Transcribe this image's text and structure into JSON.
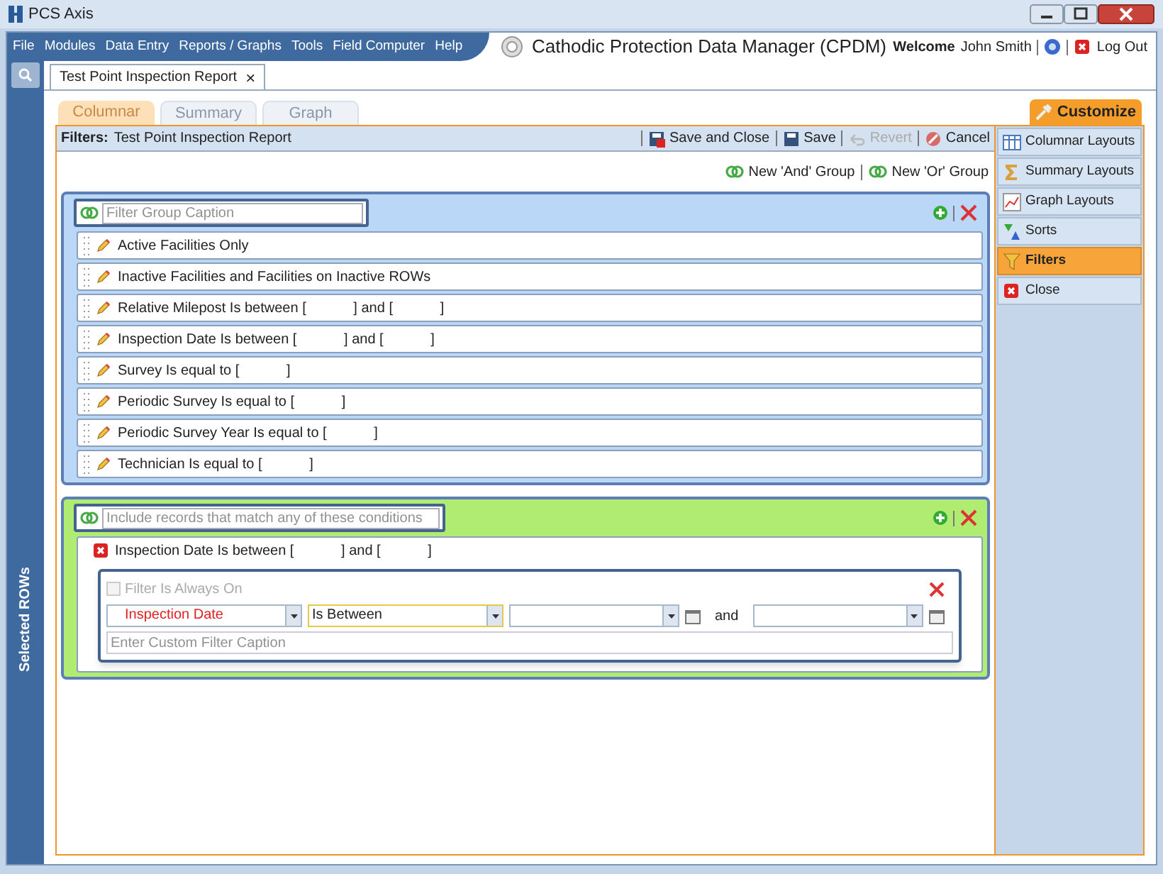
{
  "app": {
    "title": "PCS Axis"
  },
  "menu": [
    "File",
    "Modules",
    "Data Entry",
    "Reports / Graphs",
    "Tools",
    "Field Computer",
    "Help"
  ],
  "header": {
    "title": "Cathodic Protection Data Manager (CPDM)",
    "welcome": "Welcome",
    "user": "John Smith",
    "logout": "Log Out"
  },
  "document_tab": {
    "label": "Test Point Inspection Report",
    "close": "×"
  },
  "sidebar": {
    "label": "Selected ROWs"
  },
  "view_tabs": [
    {
      "label": "Columnar",
      "selected": true
    },
    {
      "label": "Summary",
      "selected": false
    },
    {
      "label": "Graph",
      "selected": false
    }
  ],
  "customize": {
    "label": "Customize"
  },
  "filters_bar": {
    "label": "Filters:",
    "value": "Test Point Inspection Report",
    "actions": [
      {
        "kind": "save_close",
        "label": "Save and Close",
        "disabled": false
      },
      {
        "kind": "save",
        "label": "Save",
        "disabled": false
      },
      {
        "kind": "revert",
        "label": "Revert",
        "disabled": true
      },
      {
        "kind": "cancel",
        "label": "Cancel",
        "disabled": false
      }
    ]
  },
  "group_actions": [
    "New 'And' Group",
    "New 'Or' Group"
  ],
  "groups": [
    {
      "kind": "and",
      "placeholder": "Filter Group Caption",
      "conditions": [
        {
          "text": "Active Facilities Only",
          "expanded": false
        },
        {
          "text": "Inactive Facilities and Facilities on Inactive ROWs",
          "expanded": false
        },
        {
          "text": "Relative Milepost Is between [            ] and [            ]",
          "expanded": false
        },
        {
          "text": "Inspection Date Is between [            ] and [            ]",
          "expanded": false
        },
        {
          "text": "Survey Is equal to [            ]",
          "expanded": false
        },
        {
          "text": "Periodic Survey Is equal to [            ]",
          "expanded": false
        },
        {
          "text": "Periodic Survey Year Is equal to [            ]",
          "expanded": false
        },
        {
          "text": "Technician Is equal to [            ]",
          "expanded": false
        }
      ]
    },
    {
      "kind": "or",
      "placeholder": "Include records that match any of these conditions",
      "conditions": [
        {
          "text": "Inspection Date Is between [            ] and [            ]",
          "expanded": true,
          "editor": {
            "always_on": {
              "label": "Filter Is Always On",
              "checked": false,
              "disabled": true
            },
            "field": "Inspection Date",
            "operator": "Is Between",
            "and_label": "and",
            "caption_placeholder": "Enter Custom Filter Caption"
          }
        }
      ]
    }
  ],
  "side_menu": [
    {
      "kind": "columnar",
      "label": "Columnar Layouts",
      "selected": false
    },
    {
      "kind": "summary",
      "label": "Summary Layouts",
      "selected": false
    },
    {
      "kind": "graph",
      "label": "Graph Layouts",
      "selected": false
    },
    {
      "kind": "sorts",
      "label": "Sorts",
      "selected": false
    },
    {
      "kind": "filters",
      "label": "Filters",
      "selected": true
    },
    {
      "kind": "close",
      "label": "Close",
      "selected": false
    }
  ]
}
